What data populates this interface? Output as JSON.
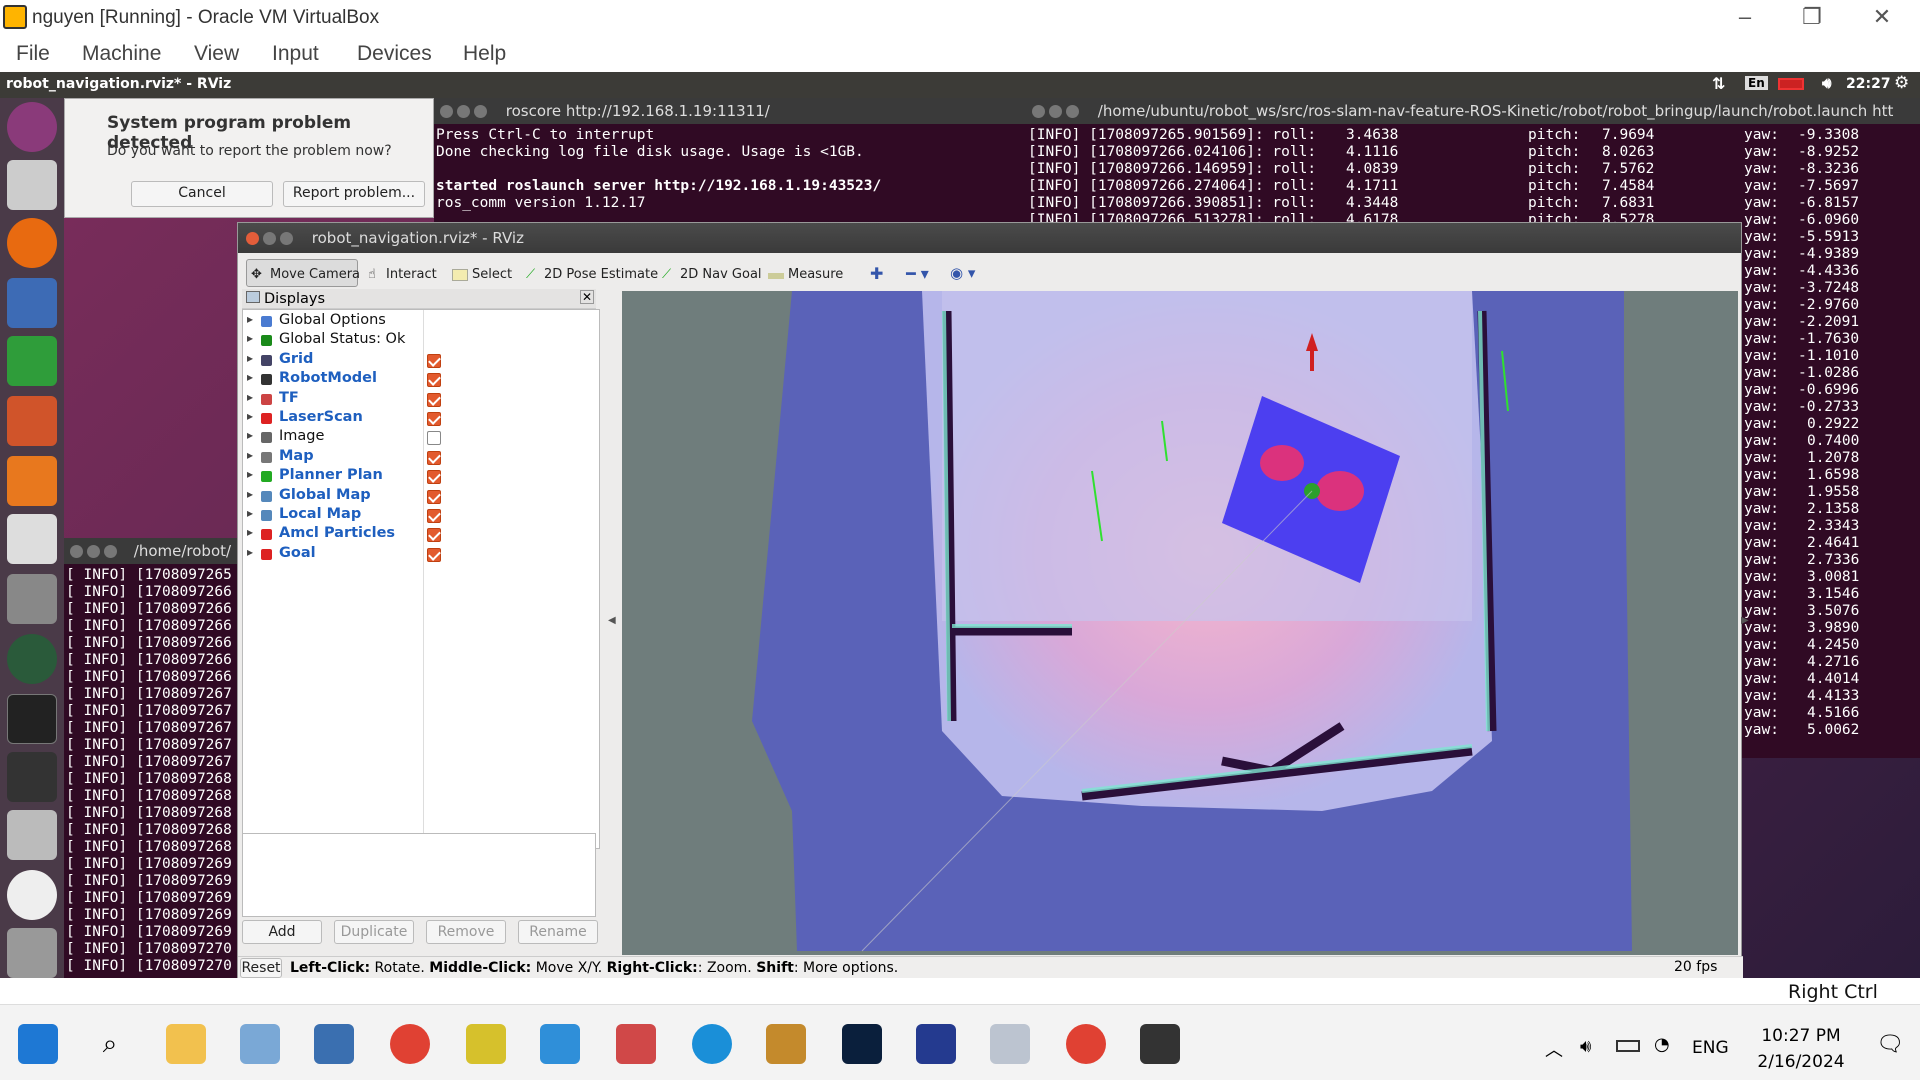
{
  "vbox": {
    "title": "nguyen [Running] - Oracle VM VirtualBox",
    "menu": [
      "File",
      "Machine",
      "View",
      "Input",
      "Devices",
      "Help"
    ],
    "host_key": "Right Ctrl"
  },
  "ubuntu_bar": {
    "title": "robot_navigation.rviz* - RViz",
    "lang": "En",
    "time": "22:27"
  },
  "dialog": {
    "title": "System program problem detected",
    "message": "Do you want to report the problem now?",
    "cancel": "Cancel",
    "report": "Report problem..."
  },
  "roscore_term": {
    "title": "roscore http://192.168.1.19:11311/",
    "lines": [
      "Press Ctrl-C to interrupt",
      "Done checking log file disk usage. Usage is <1GB.",
      "",
      "started roslaunch server http://192.168.1.19:43523/",
      "ros_comm version 1.12.17"
    ]
  },
  "launch_term": {
    "title": "/home/ubuntu/robot_ws/src/ros-slam-nav-feature-ROS-Kinetic/robot/robot_bringup/launch/robot.launch htt",
    "rows": [
      {
        "ts": "[INFO] [1708097265.901569]: roll:",
        "roll": "3.4638",
        "pitch": "7.9694"
      },
      {
        "ts": "[INFO] [1708097266.024106]: roll:",
        "roll": "4.1116",
        "pitch": "8.0263"
      },
      {
        "ts": "[INFO] [1708097266.146959]: roll:",
        "roll": "4.0839",
        "pitch": "7.5762"
      },
      {
        "ts": "[INFO] [1708097266.274064]: roll:",
        "roll": "4.1711",
        "pitch": "7.4584"
      },
      {
        "ts": "[INFO] [1708097266.390851]: roll:",
        "roll": "4.3448",
        "pitch": "7.6831"
      },
      {
        "ts": "[INFO] [1708097266.513278]: roll:",
        "roll": "4.6178",
        "pitch": "8.5278"
      }
    ],
    "pitch_label": "pitch:",
    "yaw_label": "yaw:",
    "yaw": [
      "-9.3308",
      "-8.9252",
      "-8.3236",
      "-7.5697",
      "-6.8157",
      "-6.0960",
      "-5.5913",
      "-4.9389",
      "-4.4336",
      "-3.7248",
      "-2.9760",
      "-2.2091",
      "-1.7630",
      "-1.1010",
      "-1.0286",
      "-0.6996",
      "-0.2733",
      "0.2922",
      "0.7400",
      "1.2078",
      "1.6598",
      "1.9558",
      "2.1358",
      "2.3343",
      "2.4641",
      "2.7336",
      "3.0081",
      "3.1546",
      "3.5076",
      "3.9890",
      "4.2450",
      "4.2716",
      "4.4014",
      "4.4133",
      "4.5166",
      "5.0062"
    ]
  },
  "left_term": {
    "title": "/home/robot/",
    "line_prefix": "[ INFO] [",
    "stamps": [
      "1708097265",
      "1708097266",
      "1708097266",
      "1708097266",
      "1708097266",
      "1708097266",
      "1708097266",
      "1708097267",
      "1708097267",
      "1708097267",
      "1708097267",
      "1708097267",
      "1708097268",
      "1708097268",
      "1708097268",
      "1708097268",
      "1708097268",
      "1708097269",
      "1708097269",
      "1708097269",
      "1708097269",
      "1708097269",
      "1708097270",
      "1708097270"
    ]
  },
  "rviz": {
    "title": "robot_navigation.rviz* - RViz",
    "toolbar": {
      "move_camera": "Move Camera",
      "interact": "Interact",
      "select": "Select",
      "pose": "2D Pose Estimate",
      "goal": "2D Nav Goal",
      "measure": "Measure"
    },
    "displays_title": "Displays",
    "displays": [
      {
        "label": "Global Options",
        "checkbox": null,
        "blue": false
      },
      {
        "label": "Global Status: Ok",
        "checkbox": null,
        "blue": false
      },
      {
        "label": "Grid",
        "checkbox": true,
        "blue": true
      },
      {
        "label": "RobotModel",
        "checkbox": true,
        "blue": true
      },
      {
        "label": "TF",
        "checkbox": true,
        "blue": true
      },
      {
        "label": "LaserScan",
        "checkbox": true,
        "blue": true
      },
      {
        "label": "Image",
        "checkbox": false,
        "blue": false
      },
      {
        "label": "Map",
        "checkbox": true,
        "blue": true
      },
      {
        "label": "Planner Plan",
        "checkbox": true,
        "blue": true
      },
      {
        "label": "Global Map",
        "checkbox": true,
        "blue": true
      },
      {
        "label": "Local Map",
        "checkbox": true,
        "blue": true
      },
      {
        "label": "Amcl Particles",
        "checkbox": true,
        "blue": true
      },
      {
        "label": "Goal",
        "checkbox": true,
        "blue": true
      }
    ],
    "buttons": {
      "add": "Add",
      "duplicate": "Duplicate",
      "remove": "Remove",
      "rename": "Rename"
    },
    "status": {
      "reset": "Reset",
      "left": "Left-Click:",
      "left_t": " Rotate. ",
      "middle": "Middle-Click:",
      "middle_t": " Move X/Y. ",
      "right": "Right-Click:",
      "right_t": ": Zoom. ",
      "shift": "Shift",
      "shift_t": ": More options."
    },
    "fps": "20 fps"
  },
  "windows": {
    "time": "10:27 PM",
    "date": "2/16/2024",
    "lang": "ENG"
  }
}
